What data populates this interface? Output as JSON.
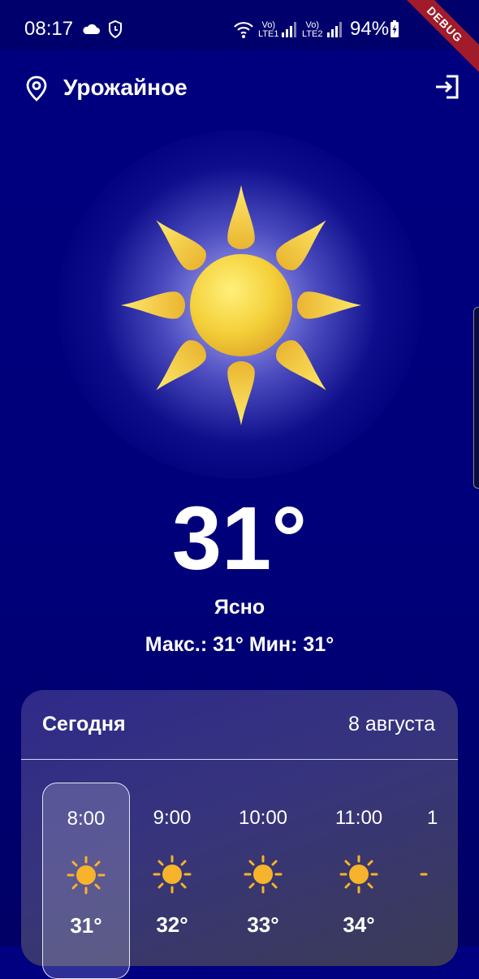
{
  "status_bar": {
    "time": "08:17",
    "battery_percent": "94%",
    "network_1": "LTE1",
    "network_2": "LTE2"
  },
  "debug_ribbon": "DEBUG",
  "header": {
    "location": "Урожайное"
  },
  "current": {
    "temperature": "31°",
    "condition": "Ясно",
    "min_max": "Макс.: 31° Мин: 31°"
  },
  "forecast": {
    "title": "Сегодня",
    "date": "8 августа",
    "hours": [
      {
        "time": "8:00",
        "temp": "31°",
        "icon": "sun-icon"
      },
      {
        "time": "9:00",
        "temp": "32°",
        "icon": "sun-icon"
      },
      {
        "time": "10:00",
        "temp": "33°",
        "icon": "sun-icon"
      },
      {
        "time": "11:00",
        "temp": "34°",
        "icon": "sun-icon"
      },
      {
        "time": "1",
        "temp": "",
        "icon": "sun-icon"
      }
    ]
  },
  "colors": {
    "background": "#000080",
    "sun": "#f5d442",
    "hour_sun": "#f7b32b"
  }
}
